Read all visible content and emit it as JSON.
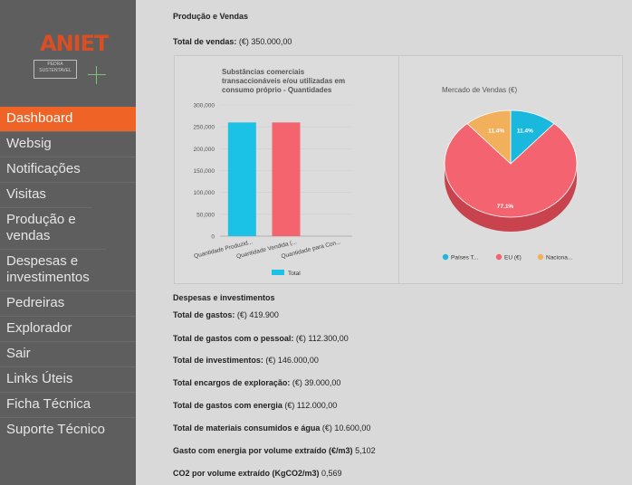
{
  "brand": {
    "name": "ANIET",
    "sub1": "PEDRA",
    "sub2": "SUSTENTAVEL"
  },
  "nav": [
    {
      "label": "Dashboard",
      "active": true
    },
    {
      "label": "Websig"
    },
    {
      "label": "Notificações"
    },
    {
      "label": "Visitas"
    },
    {
      "label": "Produção e vendas"
    },
    {
      "label": "Despesas e investimentos"
    },
    {
      "label": "Pedreiras"
    },
    {
      "label": "Explorador"
    },
    {
      "label": "Sair"
    },
    {
      "label": "Links Úteis"
    },
    {
      "label": "Ficha Técnica"
    },
    {
      "label": "Suporte Técnico"
    }
  ],
  "production": {
    "title": "Produção e Vendas",
    "total_label": "Total de vendas:",
    "total_value": "(€) 350.000,00"
  },
  "chart_data": [
    {
      "type": "bar",
      "title": "Substâncias comerciais transaccionáveis e/ou utilizadas em consumo próprio - Quantidades",
      "categories": [
        "Quantidade Produzid...",
        "Quantidade Vendida (...",
        "Quantidade para Con..."
      ],
      "series": [
        {
          "name": "Total",
          "values": [
            260000,
            260000,
            0
          ]
        }
      ],
      "bar_colors": [
        "#1cc2e6",
        "#f4646e",
        "#f4a460"
      ],
      "ylim": [
        0,
        300000
      ],
      "yticks": [
        "0",
        "50,000",
        "100,000",
        "150,000",
        "200,000",
        "250,000",
        "300,000"
      ],
      "legend": "bottom",
      "legend_color": "#1cc2e6"
    },
    {
      "type": "pie",
      "title": "Mercado de Vendas (€)",
      "labels": [
        "Países T...",
        "EU (€)",
        "Naciona..."
      ],
      "values": [
        11.4,
        77.1,
        11.4
      ],
      "data_labels": [
        "11.4%",
        "77.1%",
        "11.4%"
      ],
      "colors": [
        "#1bb8de",
        "#f46470",
        "#f2b05c"
      ],
      "legend": "bottom"
    }
  ],
  "expenses": {
    "title": "Despesas e investimentos",
    "rows": [
      {
        "label": "Total de gastos:",
        "value": "(€) 419.900"
      },
      {
        "label": "Total de gastos com o pessoal:",
        "value": "(€) 112.300,00"
      },
      {
        "label": "Total de investimentos:",
        "value": "(€) 146.000,00"
      },
      {
        "label": "Total encargos de exploração:",
        "value": "(€) 39.000,00"
      },
      {
        "label": "Total de gastos com energia",
        "value": "(€) 112.000,00"
      },
      {
        "label": "Total de materiais consumidos e água",
        "value": "(€) 10.600,00"
      },
      {
        "label": "Gasto com energia por volume extraído (€/m3)",
        "value": "5,102"
      },
      {
        "label": "CO2 por volume extraído (KgCO2/m3)",
        "value": "0,569"
      }
    ]
  }
}
